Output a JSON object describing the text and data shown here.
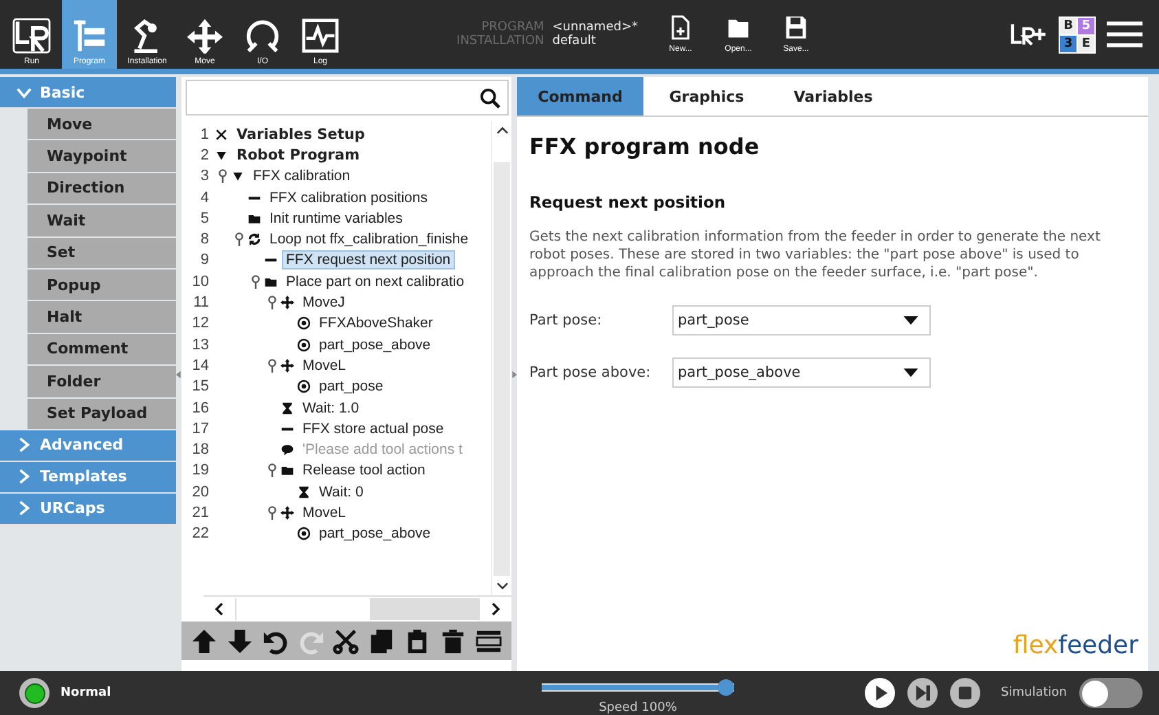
{
  "header": {
    "nav": [
      {
        "label": "Run",
        "kind": "run",
        "selected": false
      },
      {
        "label": "Program",
        "kind": "program",
        "selected": true
      },
      {
        "label": "Installation",
        "kind": "installation",
        "selected": false
      },
      {
        "label": "Move",
        "kind": "move",
        "selected": false
      },
      {
        "label": "I/O",
        "kind": "io",
        "selected": false
      },
      {
        "label": "Log",
        "kind": "log",
        "selected": false
      }
    ],
    "program_label": "PROGRAM",
    "program_value": "<unnamed>*",
    "installation_label": "INSTALLATION",
    "installation_value": "default",
    "files": [
      {
        "label": "New...",
        "kind": "new"
      },
      {
        "label": "Open...",
        "kind": "open"
      },
      {
        "label": "Save...",
        "kind": "save"
      }
    ],
    "mode_grid": [
      "B",
      "5",
      "3",
      "E"
    ]
  },
  "palette": [
    {
      "label": "Basic",
      "expanded": true,
      "items": [
        "Move",
        "Waypoint",
        "Direction",
        "Wait",
        "Set",
        "Popup",
        "Halt",
        "Comment",
        "Folder",
        "Set Payload"
      ]
    },
    {
      "label": "Advanced",
      "expanded": false
    },
    {
      "label": "Templates",
      "expanded": false
    },
    {
      "label": "URCaps",
      "expanded": false
    }
  ],
  "tree": [
    {
      "line": "1",
      "label": "Variables Setup",
      "kind": "variables",
      "selected": false
    },
    {
      "line": "2",
      "label": "Robot Program",
      "kind": "collapse",
      "selected": false,
      "expanded": true,
      "children": [
        {
          "line": "3",
          "label": "FFX calibration",
          "kind": "collapse",
          "selected": false,
          "expanded": true,
          "children": [
            {
              "line": "4",
              "label": "FFX calibration positions",
              "kind": "script",
              "selected": false
            },
            {
              "line": "5",
              "label": "Init runtime variables",
              "kind": "folder",
              "selected": false
            },
            {
              "line": "8",
              "label": "Loop not ffx_calibration_finishe",
              "kind": "loop",
              "selected": false,
              "expanded": true,
              "children": [
                {
                  "line": "9",
                  "label": "FFX request next position",
                  "kind": "script",
                  "selected": true
                },
                {
                  "line": "10",
                  "label": "Place part on next calibratio",
                  "kind": "folder",
                  "selected": false,
                  "expanded": true,
                  "children": [
                    {
                      "line": "11",
                      "label": "MoveJ",
                      "kind": "move",
                      "selected": false,
                      "expanded": true,
                      "children": [
                        {
                          "line": "12",
                          "label": "FFXAboveShaker",
                          "kind": "waypoint",
                          "selected": false
                        },
                        {
                          "line": "13",
                          "label": "part_pose_above",
                          "kind": "waypoint",
                          "selected": false
                        }
                      ]
                    },
                    {
                      "line": "14",
                      "label": "MoveL",
                      "kind": "move",
                      "selected": false,
                      "expanded": true,
                      "children": [
                        {
                          "line": "15",
                          "label": "part_pose",
                          "kind": "waypoint",
                          "selected": false
                        }
                      ]
                    },
                    {
                      "line": "16",
                      "label": "Wait: 1.0",
                      "kind": "wait",
                      "selected": false
                    },
                    {
                      "line": "17",
                      "label": "FFX store actual pose",
                      "kind": "script",
                      "selected": false
                    },
                    {
                      "line": "18",
                      "label": "'Please add tool actions t",
                      "kind": "comment",
                      "selected": false
                    },
                    {
                      "line": "19",
                      "label": "Release tool action",
                      "kind": "folder",
                      "selected": false,
                      "expanded": true,
                      "children": [
                        {
                          "line": "20",
                          "label": "Wait: 0",
                          "kind": "wait",
                          "selected": false
                        }
                      ]
                    },
                    {
                      "line": "21",
                      "label": "MoveL",
                      "kind": "move",
                      "selected": false,
                      "expanded": true,
                      "children": [
                        {
                          "line": "22",
                          "label": "part_pose_above",
                          "kind": "waypoint",
                          "selected": false
                        }
                      ]
                    }
                  ]
                }
              ]
            }
          ]
        }
      ]
    }
  ],
  "toolbar": [
    {
      "kind": "up",
      "disabled": false
    },
    {
      "kind": "down",
      "disabled": false
    },
    {
      "kind": "undo",
      "disabled": false
    },
    {
      "kind": "redo",
      "disabled": true
    },
    {
      "kind": "cut",
      "disabled": false
    },
    {
      "kind": "copy",
      "disabled": false
    },
    {
      "kind": "paste",
      "disabled": false
    },
    {
      "kind": "delete",
      "disabled": false
    },
    {
      "kind": "suppress",
      "disabled": false
    }
  ],
  "tabs": [
    {
      "label": "Command",
      "selected": true
    },
    {
      "label": "Graphics",
      "selected": false
    },
    {
      "label": "Variables",
      "selected": false
    }
  ],
  "node_title": "FFX program node",
  "section_title": "Request next position",
  "description": "Gets the next calibration information from the feeder in order to generate the next robot poses. These are stored in two variables: the \"part pose above\" is used to approach the final calibration pose on the feeder surface, i.e. \"part pose\".",
  "fields": [
    {
      "label": "Part pose:",
      "value": "part_pose"
    },
    {
      "label": "Part pose above:",
      "value": "part_pose_above"
    }
  ],
  "logo": {
    "first": "flex",
    "second": "feeder"
  },
  "footer": {
    "status": "Normal",
    "color": "#22bb22",
    "level": 1.0,
    "speed": "Speed 100%",
    "simulation_label": "Simulation",
    "simulation_on": false
  }
}
